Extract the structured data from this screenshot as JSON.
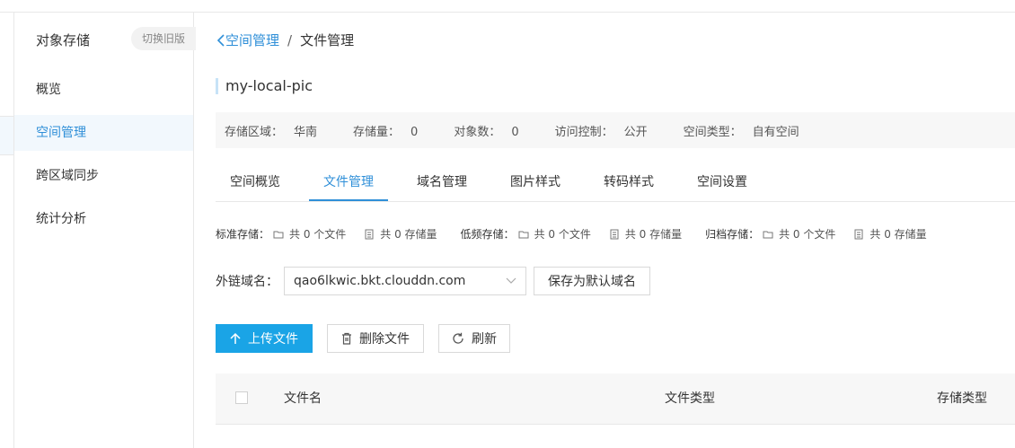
{
  "sidebar": {
    "title": "对象存储",
    "switch_label": "切换旧版",
    "items": [
      {
        "label": "概览"
      },
      {
        "label": "空间管理"
      },
      {
        "label": "跨区域同步"
      },
      {
        "label": "统计分析"
      }
    ],
    "active_index": 1
  },
  "breadcrumb": {
    "back_label": "空间管理",
    "separator": "/",
    "current": "文件管理"
  },
  "bucket": {
    "name": "my-local-pic"
  },
  "info": [
    {
      "label": "存储区域：",
      "value": "华南"
    },
    {
      "label": "存储量：",
      "value": "0"
    },
    {
      "label": "对象数：",
      "value": "0"
    },
    {
      "label": "访问控制：",
      "value": "公开"
    },
    {
      "label": "空间类型：",
      "value": "自有空间"
    }
  ],
  "tabs": [
    {
      "label": "空间概览"
    },
    {
      "label": "文件管理"
    },
    {
      "label": "域名管理"
    },
    {
      "label": "图片样式"
    },
    {
      "label": "转码样式"
    },
    {
      "label": "空间设置"
    }
  ],
  "active_tab": 1,
  "stats": [
    {
      "label": "标准存储：",
      "files": "共 0 个文件",
      "size": "共 0 存储量"
    },
    {
      "label": "低频存储：",
      "files": "共 0 个文件",
      "size": "共 0 存储量"
    },
    {
      "label": "归档存储：",
      "files": "共 0 个文件",
      "size": "共 0 存储量"
    }
  ],
  "domain": {
    "label": "外链域名：",
    "value": "qao6lkwic.bkt.clouddn.com",
    "save_label": "保存为默认域名"
  },
  "actions": {
    "upload_label": "上传文件",
    "delete_label": "删除文件",
    "refresh_label": "刷新"
  },
  "table": {
    "columns": [
      "文件名",
      "文件类型",
      "存储类型"
    ]
  },
  "colors": {
    "accent": "#2f8fd8",
    "primary_button": "#1aa4e6",
    "active_bg": "#f2f8fd"
  }
}
